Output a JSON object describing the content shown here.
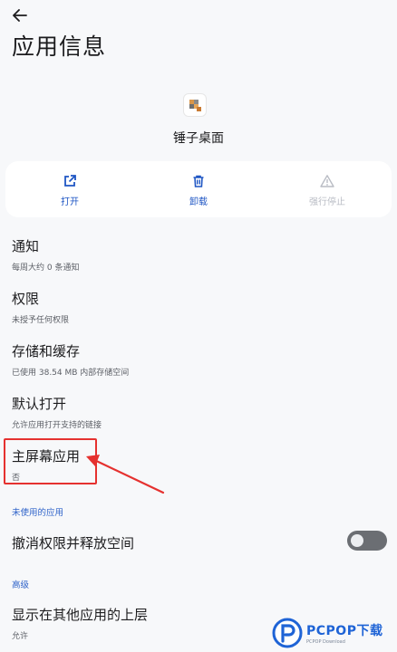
{
  "page": {
    "title": "应用信息"
  },
  "app": {
    "name": "锤子桌面",
    "icon": "app-icon"
  },
  "actions": [
    {
      "label": "打开",
      "icon": "open-external-icon",
      "enabled": true
    },
    {
      "label": "卸载",
      "icon": "trash-icon",
      "enabled": true
    },
    {
      "label": "强行停止",
      "icon": "warning-icon",
      "enabled": false
    }
  ],
  "settings": {
    "notifications": {
      "title": "通知",
      "subtitle": "每周大约 0 条通知"
    },
    "permissions": {
      "title": "权限",
      "subtitle": "未授予任何权限"
    },
    "storage": {
      "title": "存储和缓存",
      "subtitle": "已使用 38.54 MB 内部存储空间"
    },
    "default_open": {
      "title": "默认打开",
      "subtitle": "允许应用打开支持的链接"
    },
    "home_app": {
      "title": "主屏幕应用",
      "subtitle": "否"
    }
  },
  "unused_section": {
    "header": "未使用的应用",
    "revoke": {
      "title": "撤消权限并释放空间",
      "toggle_on": false
    }
  },
  "advanced_section": {
    "header": "高级",
    "overlay": {
      "title": "显示在其他应用的上层",
      "subtitle": "允许"
    }
  },
  "annotation": {
    "color": "#e5312f"
  },
  "watermark": {
    "text": "PCPOP下载",
    "sub": "PCPOP Download"
  },
  "colors": {
    "accent": "#1f56c4",
    "background": "#f7f8fa",
    "disabled": "#b9bcc4"
  }
}
